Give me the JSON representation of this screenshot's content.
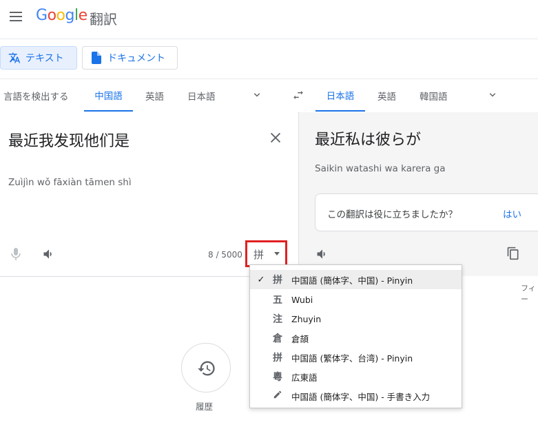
{
  "header": {
    "logo_text": "Google",
    "app_name": "翻訳"
  },
  "modes": {
    "text_label": "テキスト",
    "document_label": "ドキュメント"
  },
  "source_langs": {
    "detect": "言語を検出する",
    "items": [
      "中国語",
      "英語",
      "日本語"
    ],
    "active": "中国語"
  },
  "target_langs": {
    "items": [
      "日本語",
      "英語",
      "韓国語"
    ],
    "active": "日本語"
  },
  "source": {
    "text": "最近我发现他们是",
    "romanization": "Zuìjìn wǒ fāxiàn tāmen shì",
    "char_count": "8 / 5000",
    "ime_glyph": "拼"
  },
  "target": {
    "text": "最近私は彼らが",
    "romanization": "Saikin watashi wa karera ga",
    "feedback_question": "この翻訳は役に立ちましたか？",
    "feedback_yes": "はい"
  },
  "feedback_link": "フィー",
  "history": {
    "label": "履歴"
  },
  "ime_menu": {
    "items": [
      {
        "glyph": "拼",
        "label": "中国語 (簡体字、中国) - Pinyin",
        "selected": true
      },
      {
        "glyph": "五",
        "label": "Wubi"
      },
      {
        "glyph": "注",
        "label": "Zhuyin"
      },
      {
        "glyph": "倉",
        "label": "倉頡"
      },
      {
        "glyph": "拼",
        "label": "中国語 (繁体字、台湾) - Pinyin"
      },
      {
        "glyph": "粵",
        "label": "広東語"
      },
      {
        "glyph": "pencil-icon",
        "label": "中国語 (簡体字、中国) - 手書き入力"
      }
    ]
  },
  "colors": {
    "accent": "#1a73e8",
    "highlight_box": "#e02020"
  }
}
